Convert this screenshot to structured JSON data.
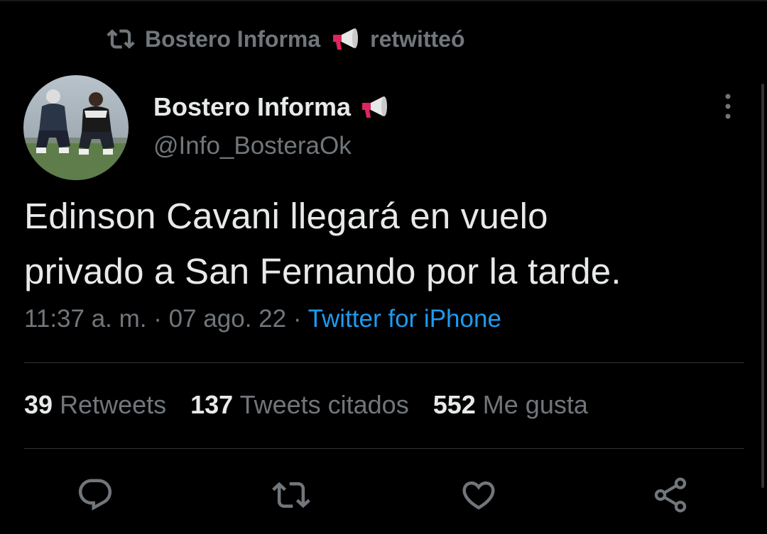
{
  "retweet_banner": {
    "account": "Bostero Informa",
    "action": "retwitteó"
  },
  "author": {
    "display_name": "Bostero Informa",
    "handle": "@Info_BosteraOk"
  },
  "tweet": {
    "text_line1": "Edinson Cavani llegará en vuelo",
    "text_line2": "privado a San Fernando por la tarde.",
    "time": "11:37 a. m.",
    "separator": "·",
    "date": "07 ago. 22",
    "source": "Twitter for iPhone"
  },
  "stats": {
    "retweets_count": "39",
    "retweets_label": "Retweets",
    "quotes_count": "137",
    "quotes_label": "Tweets citados",
    "likes_count": "552",
    "likes_label": "Me gusta"
  },
  "actions": [
    "reply-icon",
    "retweet-icon",
    "like-icon",
    "share-icon"
  ],
  "colors": {
    "background": "#000000",
    "primary_text": "#e7e9ea",
    "secondary_text": "#71767b",
    "link": "#1d9bf0",
    "divider": "#2f3336",
    "megaphone_red": "#e0245e"
  }
}
